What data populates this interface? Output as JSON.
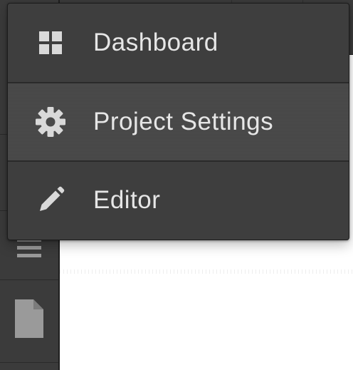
{
  "menu": {
    "items": [
      {
        "label": "Dashboard",
        "icon": "dashboard-grid-icon",
        "active": false
      },
      {
        "label": "Project Settings",
        "icon": "gear-icon",
        "active": true
      },
      {
        "label": "Editor",
        "icon": "pencil-icon",
        "active": false
      }
    ]
  },
  "sidebar": {
    "icons": [
      "hamburger-menu-icon",
      "document-icon"
    ]
  },
  "colors": {
    "menu_background": "#3e3e3e",
    "menu_active_background": "#484848",
    "menu_text": "#e6e6e6",
    "icon": "#d9d9d9",
    "rail_background": "#3b3b3b",
    "rail_icon": "#9a9a9a"
  }
}
